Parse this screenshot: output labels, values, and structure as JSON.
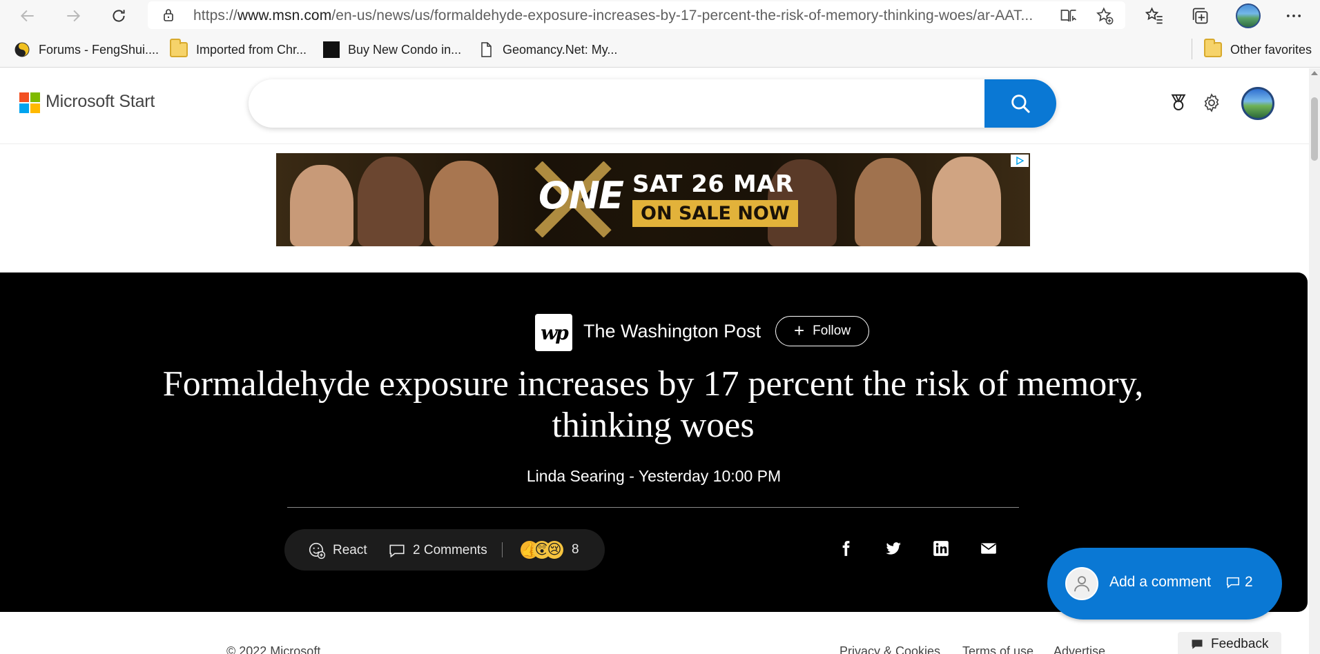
{
  "browser": {
    "url_prefix": "https://",
    "url_domain": "www.msn.com",
    "url_path": "/en-us/news/us/formaldehyde-exposure-increases-by-17-percent-the-risk-of-memory-thinking-woes/ar-AAT...",
    "accent_color": "#0a78d4"
  },
  "bookmarks": [
    {
      "label": "Forums - FengShui....",
      "icon": "yin-yang-icon"
    },
    {
      "label": "Imported from Chr...",
      "icon": "folder-icon"
    },
    {
      "label": "Buy New Condo in...",
      "icon": "site-favicon"
    },
    {
      "label": "Geomancy.Net: My...",
      "icon": "page-icon"
    },
    {
      "label": "Other favorites",
      "icon": "folder-icon"
    }
  ],
  "header": {
    "brand": "Microsoft Start",
    "search_placeholder": ""
  },
  "ad": {
    "brand": "ONE",
    "date": "SAT 26 MAR",
    "cta": "ON SALE NOW"
  },
  "article": {
    "publisher": "The Washington Post",
    "publisher_logo": "wp",
    "follow_label": "Follow",
    "headline": "Formaldehyde exposure increases by 17 percent the risk of memory, thinking woes",
    "byline": "Linda Searing - Yesterday 10:00 PM",
    "react_label": "React",
    "comments_label": "2 Comments",
    "reaction_count": "8"
  },
  "comment_fab": {
    "label": "Add a comment",
    "count": "2"
  },
  "footer": {
    "copyright": "© 2022 Microsoft",
    "links": [
      "Privacy & Cookies",
      "Terms of use",
      "Advertise"
    ],
    "feedback_label": "Feedback"
  }
}
